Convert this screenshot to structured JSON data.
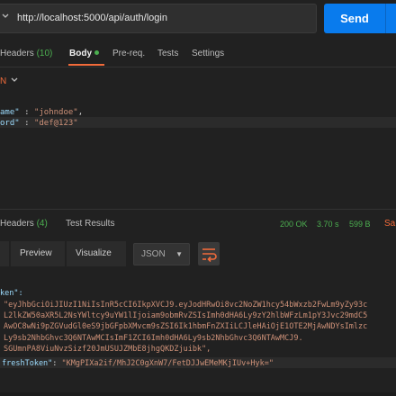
{
  "request": {
    "url": "http://localhost:5000/api/auth/login",
    "send_label": "Send"
  },
  "request_tabs": {
    "headers_label": "Headers",
    "headers_count": "(10)",
    "body_label": "Body",
    "prereq_label": "Pre-req.",
    "tests_label": "Tests",
    "settings_label": "Settings"
  },
  "body_type": {
    "label": "N"
  },
  "request_body": {
    "line1_key": "ame\"",
    "line1_sep": " : ",
    "line1_value": "\"johndoe\"",
    "line1_end": ",",
    "line2_key": "ord\"",
    "line2_sep": " : ",
    "line2_value": "\"def@123\""
  },
  "response_tabs": {
    "headers_label": "Headers",
    "headers_count": "(4)",
    "test_results_label": "Test Results",
    "status": "200 OK",
    "time": "3.70 s",
    "size": "599 B",
    "save_label": "Sa"
  },
  "response_toolbar": {
    "preview_label": "Preview",
    "visualize_label": "Visualize",
    "format_label": "JSON"
  },
  "response_body": {
    "line1": "ken\":",
    "line2": "\"eyJhbGciOiJIUzI1NiIsInR5cCI6IkpXVCJ9.eyJodHRwOi8vc2NoZW1hcy54bWxzb2FwLm9yZy93c",
    "line3": "L2lkZW50aXR5L2NsYWltcy9uYW1lIjoiam9obmRvZSIsImh0dHA6Ly9zY2hlbWFzLm1pY3Jvc29mdC5",
    "line4": "AwOC8wNi9pZGVudGl0eS9jbGFpbXMvcm9sZSI6Ik1hbmFnZXIiLCJleHAiOjE1OTE2MjAwNDYsImlzc",
    "line5": "Ly9sb2NhbGhvc3Q6NTAwMCIsImF1ZCI6Imh0dHA6Ly9sb2NhbGhvc3Q6NTAwMCJ9.",
    "line6": "SGUmnPA8ViuNvzSizf20JmUSUJZMbE8jhgQKDZjuibk\",",
    "line7_key": "freshToken\"",
    "line7_sep": ": ",
    "line7_value": "\"KMgPIXa2if/MhJ2C0gXnW7/FetDJJwEMeMKjIUv+Hyk=\""
  }
}
